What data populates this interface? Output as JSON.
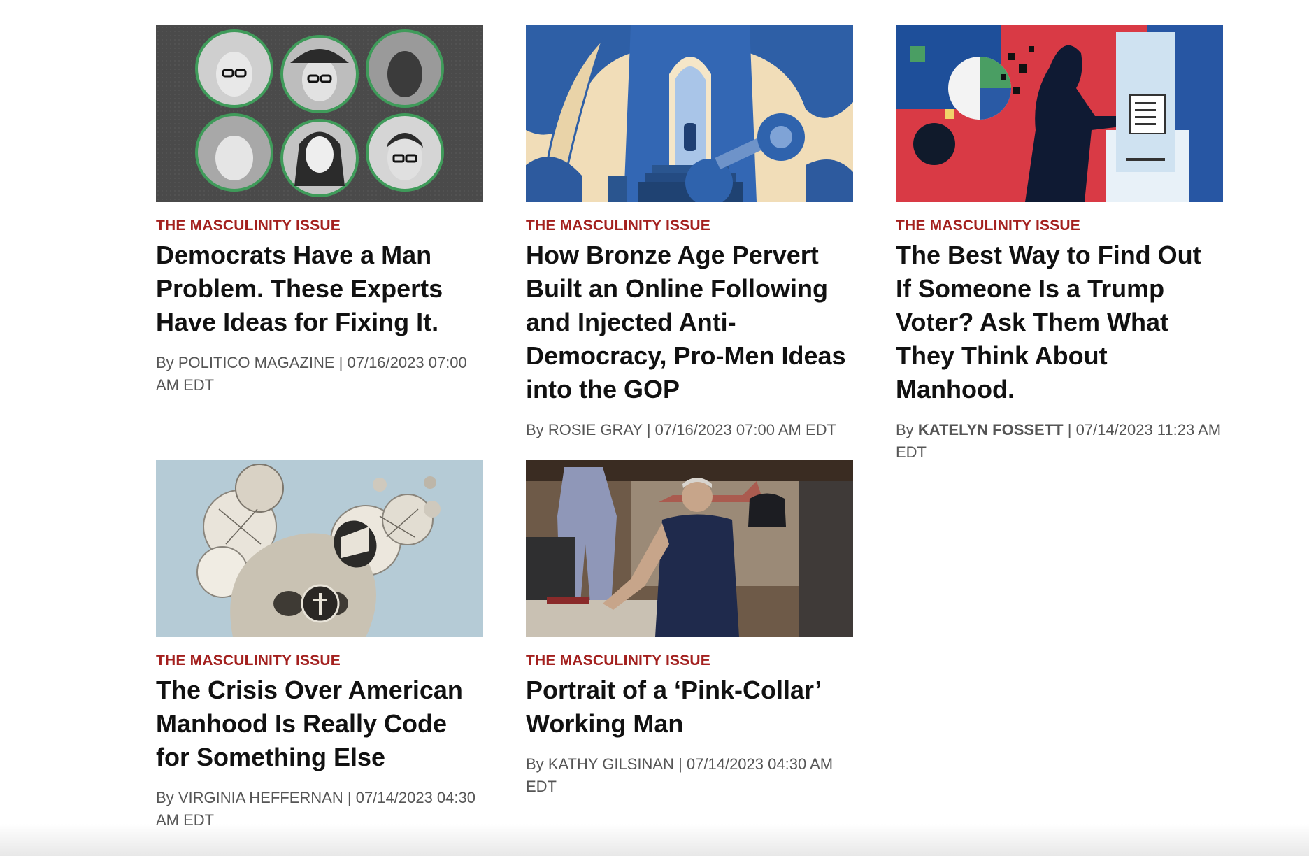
{
  "articles": [
    {
      "kicker": "THE MASCULINITY ISSUE",
      "headline": "Democrats Have a Man Problem. These Experts Have Ideas for Fixing It.",
      "by": "By",
      "author": "POLITICO MAGAZINE",
      "sep": "|",
      "timestamp": "07/16/2023 07:00 AM EDT",
      "image": "expert-panel-headshots"
    },
    {
      "kicker": "THE MASCULINITY ISSUE",
      "headline": "How Bronze Age Pervert Built an Online Following and Injected Anti-Democracy, Pro-Men Ideas into the GOP",
      "by": "By",
      "author": "ROSIE GRAY",
      "sep": "|",
      "timestamp": "07/16/2023 07:00 AM EDT",
      "image": "bronze-statue-illustration"
    },
    {
      "kicker": "THE MASCULINITY ISSUE",
      "headline": "The Best Way to Find Out If Someone Is a Trump Voter? Ask Them What They Think About Manhood.",
      "by": "By",
      "author": "KATELYN FOSSETT",
      "sep": "|",
      "timestamp": "07/14/2023 11:23 AM EDT",
      "image": "voter-booth-illustration"
    },
    {
      "kicker": "THE MASCULINITY ISSUE",
      "headline": "The Crisis Over American Manhood Is Really Code for Something Else",
      "by": "By",
      "author": "VIRGINIA HEFFERNAN",
      "sep": "|",
      "timestamp": "07/14/2023 04:30 AM EDT",
      "image": "skull-collage-illustration"
    },
    {
      "kicker": "THE MASCULINITY ISSUE",
      "headline": "Portrait of a ‘Pink-Collar’ Working Man",
      "by": "By",
      "author": "KATHY GILSINAN",
      "sep": "|",
      "timestamp": "07/14/2023 04:30 AM EDT",
      "image": "working-man-photo"
    }
  ],
  "colors": {
    "kicker": "#a3201e",
    "headline": "#111111",
    "byline": "#555555",
    "background": "#ffffff"
  }
}
